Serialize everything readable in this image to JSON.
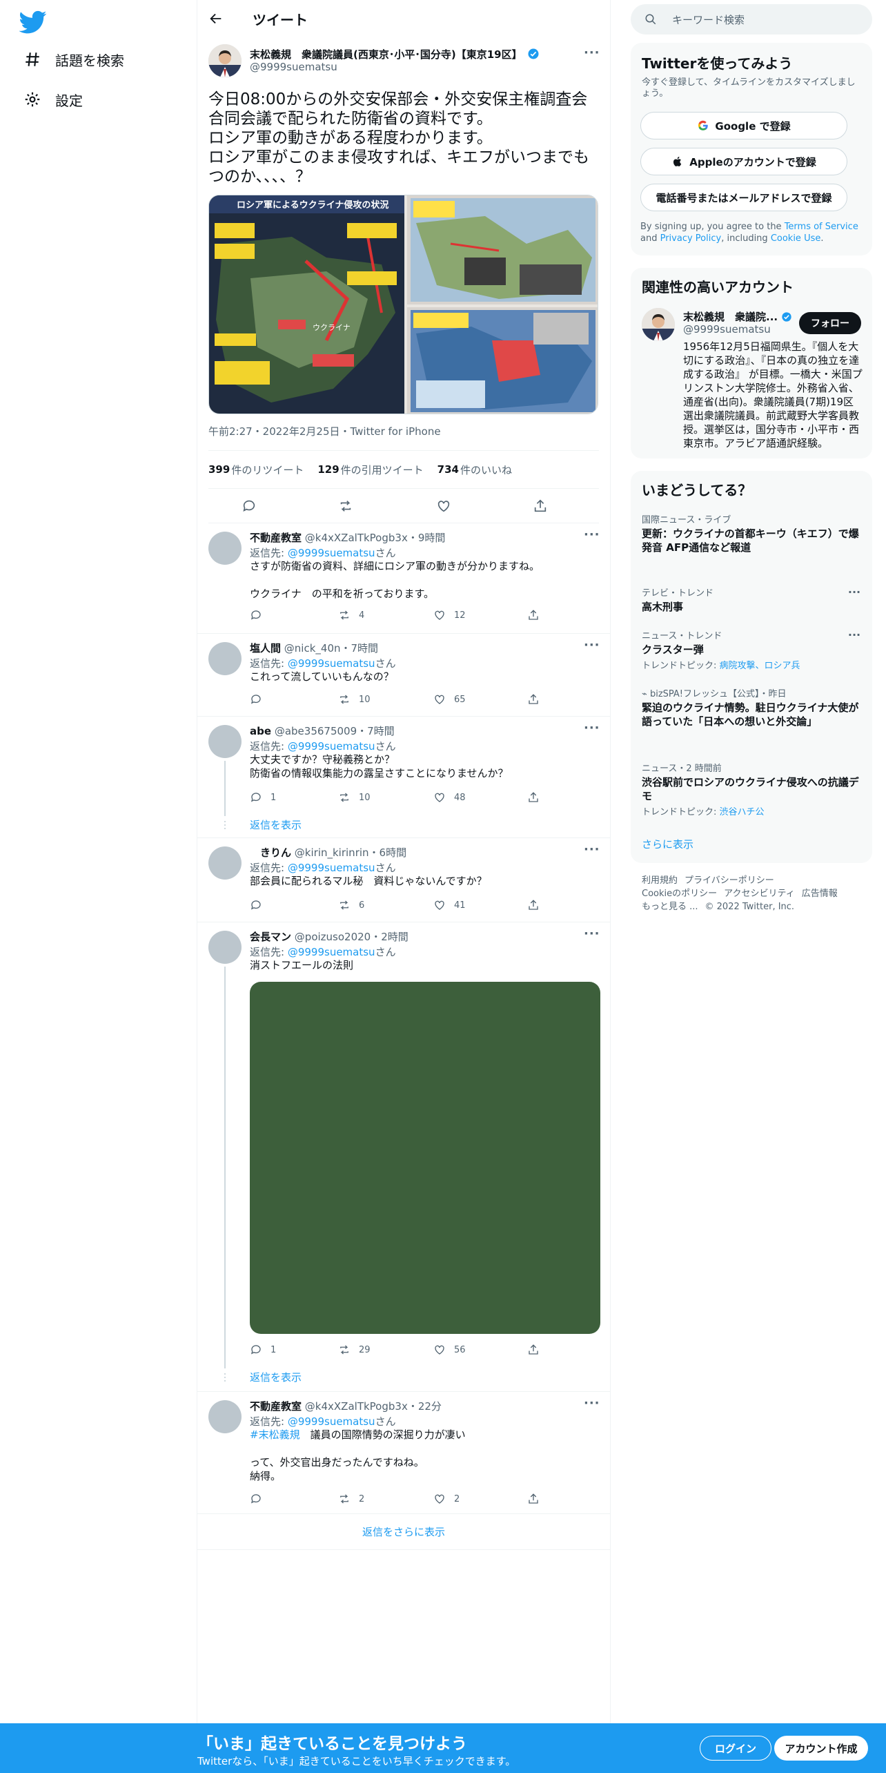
{
  "nav": {
    "explore_label": "話題を検索",
    "settings_label": "設定"
  },
  "header": {
    "title": "ツイート"
  },
  "tweet": {
    "author_name": "末松義規　衆議院議員(西東京･小平･国分寺)【東京19区】",
    "author_handle": "@9999suematsu",
    "text": "今日08:00からの外交安保部会・外交安保主権調査会合同会議で配られた防衛省の資料です。\nロシア軍の動きがある程度わかります。\nロシア軍がこのまま侵攻すれば、キエフがいつまでもつのか、、、、？",
    "timestamp": "午前2:27・2022年2月25日・Twitter for iPhone",
    "retweets": "399",
    "retweets_label": "件のリツイート",
    "quotes": "129",
    "quotes_label": "件の引用ツイート",
    "likes": "734",
    "likes_label": "件のいいね",
    "media_caption_main": "ロシア軍によるウクライナ侵攻の状況",
    "media_map_label": "ウクライナ"
  },
  "replies": [
    {
      "name": "不動産教室",
      "handle": "@k4xXZalTkPogb3x",
      "time": "・9時間",
      "reply_to_prefix": "返信先: ",
      "reply_to": "@9999suematsu",
      "reply_to_suffix": "さん",
      "text": "さすが防衛省の資料、詳細にロシア軍の動きが分かりますね。\n\nウクライナ　の平和を祈っております。",
      "replies": "",
      "retweets": "4",
      "likes": "12"
    },
    {
      "name": "塩人間",
      "handle": "@nick_40n",
      "time": "・7時間",
      "reply_to_prefix": "返信先: ",
      "reply_to": "@9999suematsu",
      "reply_to_suffix": "さん",
      "text": "これって流していいもんなの？",
      "replies": "",
      "retweets": "10",
      "likes": "65"
    },
    {
      "name": "abe",
      "handle": "@abe35675009",
      "time": "・7時間",
      "reply_to_prefix": "返信先: ",
      "reply_to": "@9999suematsu",
      "reply_to_suffix": "さん",
      "text": "大丈夫ですか？守秘義務とか？\n防衛省の情報収集能力の露呈さすことになりませんか？",
      "replies": "1",
      "retweets": "10",
      "likes": "48",
      "show_replies": "返信を表示"
    },
    {
      "name": "　きりん",
      "handle": "@kirin_kirinrin",
      "time": "・6時間",
      "reply_to_prefix": "返信先: ",
      "reply_to": "@9999suematsu",
      "reply_to_suffix": "さん",
      "text": "部会員に配られるマル秘　資料じゃないんですか？",
      "replies": "",
      "retweets": "6",
      "likes": "41"
    },
    {
      "name": "会長マン",
      "handle": "@poizuso2020",
      "time": "・2時間",
      "reply_to_prefix": "返信先: ",
      "reply_to": "@9999suematsu",
      "reply_to_suffix": "さん",
      "text": "消ストフエールの法則",
      "replies": "1",
      "retweets": "29",
      "likes": "56",
      "show_replies": "返信を表示",
      "media_color": "#3d5f3b"
    },
    {
      "name": "不動産教室",
      "handle": "@k4xXZalTkPogb3x",
      "time": "・22分",
      "reply_to_prefix": "返信先: ",
      "reply_to": "@9999suematsu",
      "reply_to_suffix": "さん",
      "hashtag": "#末松義規",
      "text_after_hashtag": "　議員の国際情勢の深掘り力が凄い",
      "text": "\n\nって、外交官出身だったんですねね。\n納得。",
      "replies": "",
      "retweets": "2",
      "likes": "2"
    }
  ],
  "more_replies": "返信をさらに表示",
  "search": {
    "placeholder": "キーワード検索"
  },
  "signup": {
    "title": "Twitterを使ってみよう",
    "subtitle": "今すぐ登録して、タイムラインをカスタマイズしましょう。",
    "google": "Google で登録",
    "apple": "Appleのアカウントで登録",
    "phone": "電話番号またはメールアドレスで登録",
    "note_prefix": "By signing up, you agree to the ",
    "terms": "Terms of Service",
    "and": " and ",
    "privacy": "Privacy Policy",
    "including": ", including ",
    "cookie": "Cookie Use",
    "period": "."
  },
  "related": {
    "title": "関連性の高いアカウント",
    "name": "末松義規　衆議院...",
    "handle": "@9999suematsu",
    "follow": "フォロー",
    "bio": "1956年12月5日福岡県生。『個人を大切にする政治』、『日本の真の独立を達成する政治』 が目標。一橋大・米国プリンストン大学院修士。外務省入省、通産省(出向)。衆議院議員(7期)19区選出衆議院議員。前武蔵野大学客員教授。選挙区は，国分寺市・小平市・西東京市。アラビア語通訳経験。"
  },
  "trends": {
    "title": "いまどうしてる？",
    "items": [
      {
        "context": "国際ニュース・ライブ",
        "title": "更新：ウクライナの首都キーウ（キエフ）で爆発音 AFP通信など報道",
        "topic": ""
      },
      {
        "context": "テレビ・トレンド",
        "title": "高木刑事",
        "topic": ""
      },
      {
        "context": "ニュース・トレンド",
        "title": "クラスター弾",
        "topic_prefix": "トレンドトピック: ",
        "topic": "病院攻撃、ロシア兵"
      },
      {
        "context": "bizSPA!フレッシュ【公式】・昨日",
        "title": "緊迫のウクライナ情勢。駐日ウクライナ大使が語っていた「日本への想いと外交論」",
        "topic": ""
      },
      {
        "context": "ニュース・2 時間前",
        "title": "渋谷駅前でロシアのウクライナ侵攻への抗議デモ",
        "topic_prefix": "トレンドトピック: ",
        "topic": "渋谷ハチ公"
      }
    ],
    "show_more": "さらに表示"
  },
  "footer": {
    "terms": "利用規約",
    "privacy": "プライバシーポリシー",
    "cookie": "Cookieのポリシー",
    "accessibility": "アクセシビリティ",
    "ads": "広告情報",
    "more": "もっと見る ...",
    "copyright": "© 2022 Twitter, Inc."
  },
  "banner": {
    "headline": "「いま」起きていることを見つけよう",
    "sub": "Twitterなら、「いま」起きていることをいち早くチェックできます。",
    "login": "ログイン",
    "signup": "アカウント作成"
  },
  "colors": {
    "accent": "#1d9bf0",
    "text": "#0f1419",
    "secondary": "#536471"
  }
}
